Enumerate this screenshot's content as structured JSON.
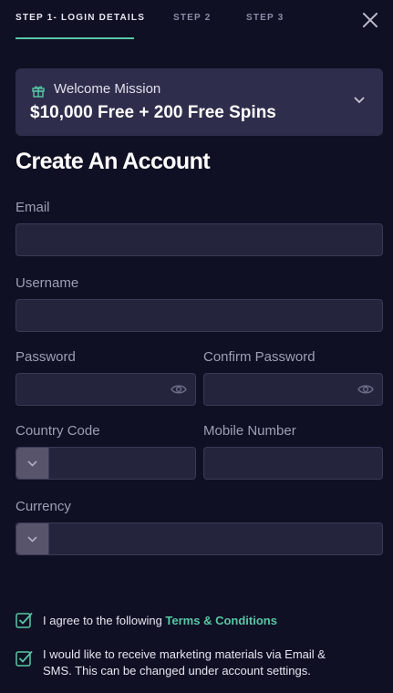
{
  "tabs": [
    {
      "label": "STEP 1- LOGIN DETAILS",
      "active": true
    },
    {
      "label": "STEP 2",
      "active": false
    },
    {
      "label": "STEP 3",
      "active": false
    }
  ],
  "promo": {
    "subtitle": "Welcome Mission",
    "title": "$10,000 Free + 200 Free Spins"
  },
  "form": {
    "heading": "Create An Account",
    "email": {
      "label": "Email",
      "value": ""
    },
    "username": {
      "label": "Username",
      "value": ""
    },
    "password": {
      "label": "Password",
      "value": ""
    },
    "confirm_password": {
      "label": "Confirm Password",
      "value": ""
    },
    "country_code": {
      "label": "Country Code",
      "value": ""
    },
    "mobile_number": {
      "label": "Mobile Number",
      "value": ""
    },
    "currency": {
      "label": "Currency",
      "value": ""
    }
  },
  "agreements": {
    "terms_prefix": "I agree to the following ",
    "terms_link": "Terms & Conditions",
    "marketing_line1": "I would like to receive marketing materials via Email &",
    "marketing_line2": "SMS. This can be changed under account settings."
  },
  "colors": {
    "background": "#101024",
    "panel": "#2e2d4b",
    "input": "#25243d",
    "accent": "#58c7a5"
  }
}
